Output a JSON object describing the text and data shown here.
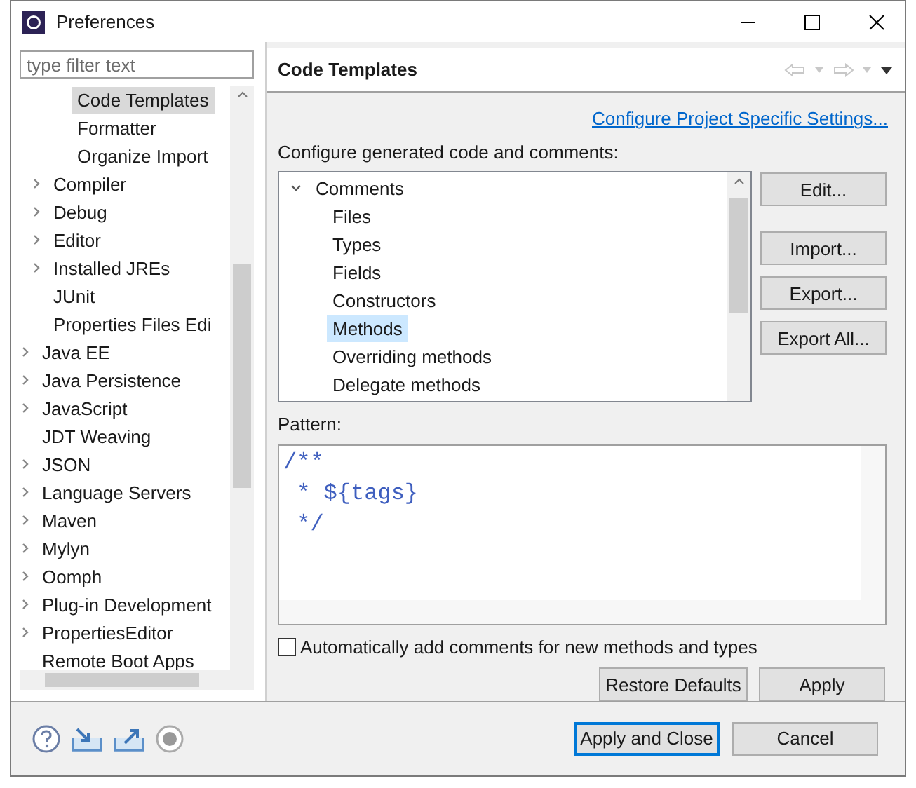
{
  "window": {
    "title": "Preferences"
  },
  "filter": {
    "placeholder": "type filter text"
  },
  "nav_tree": [
    {
      "children": [
        {
          "children": [
            {
              "label": "Code Templates",
              "has_children": false,
              "selected": true
            },
            {
              "label": "Formatter",
              "has_children": false,
              "selected": false
            },
            {
              "label": "Organize Import",
              "has_children": false,
              "selected": false
            }
          ]
        },
        {
          "label": "Compiler",
          "has_children": true,
          "selected": false
        },
        {
          "label": "Debug",
          "has_children": true,
          "selected": false
        },
        {
          "label": "Editor",
          "has_children": true,
          "selected": false
        },
        {
          "label": "Installed JREs",
          "has_children": true,
          "selected": false
        },
        {
          "label": "JUnit",
          "has_children": false,
          "selected": false
        },
        {
          "label": "Properties Files Edi",
          "has_children": false,
          "selected": false
        }
      ]
    },
    {
      "label": "Java EE",
      "has_children": true,
      "selected": false
    },
    {
      "label": "Java Persistence",
      "has_children": true,
      "selected": false
    },
    {
      "label": "JavaScript",
      "has_children": true,
      "selected": false
    },
    {
      "label": "JDT Weaving",
      "has_children": false,
      "selected": false
    },
    {
      "label": "JSON",
      "has_children": true,
      "selected": false
    },
    {
      "label": "Language Servers",
      "has_children": true,
      "selected": false
    },
    {
      "label": "Maven",
      "has_children": true,
      "selected": false
    },
    {
      "label": "Mylyn",
      "has_children": true,
      "selected": false
    },
    {
      "label": "Oomph",
      "has_children": true,
      "selected": false
    },
    {
      "label": "Plug-in Development",
      "has_children": true,
      "selected": false
    },
    {
      "label": "PropertiesEditor",
      "has_children": true,
      "selected": false
    },
    {
      "label": "Remote Boot Apps",
      "has_children": false,
      "selected": false
    }
  ],
  "page": {
    "title": "Code Templates",
    "link": "Configure Project Specific Settings...",
    "intro": "Configure generated code and comments:"
  },
  "templates": [
    {
      "label": "Comments",
      "expanded": true,
      "selected": false,
      "children": [
        {
          "label": "Files",
          "selected": false
        },
        {
          "label": "Types",
          "selected": false
        },
        {
          "label": "Fields",
          "selected": false
        },
        {
          "label": "Constructors",
          "selected": false
        },
        {
          "label": "Methods",
          "selected": true
        },
        {
          "label": "Overriding methods",
          "selected": false
        },
        {
          "label": "Delegate methods",
          "selected": false
        }
      ]
    }
  ],
  "side_buttons": [
    "Edit...",
    "Import...",
    "Export...",
    "Export All..."
  ],
  "pattern": {
    "label": "Pattern:",
    "lines": [
      "/**",
      " * ${tags}",
      " */"
    ]
  },
  "auto_comments": {
    "label": "Automatically add comments for new methods and types",
    "checked": false
  },
  "page_buttons": [
    "Restore Defaults",
    "Apply"
  ],
  "dialog_buttons": [
    {
      "label": "Apply and Close",
      "default": true
    },
    {
      "label": "Cancel",
      "default": false
    }
  ]
}
